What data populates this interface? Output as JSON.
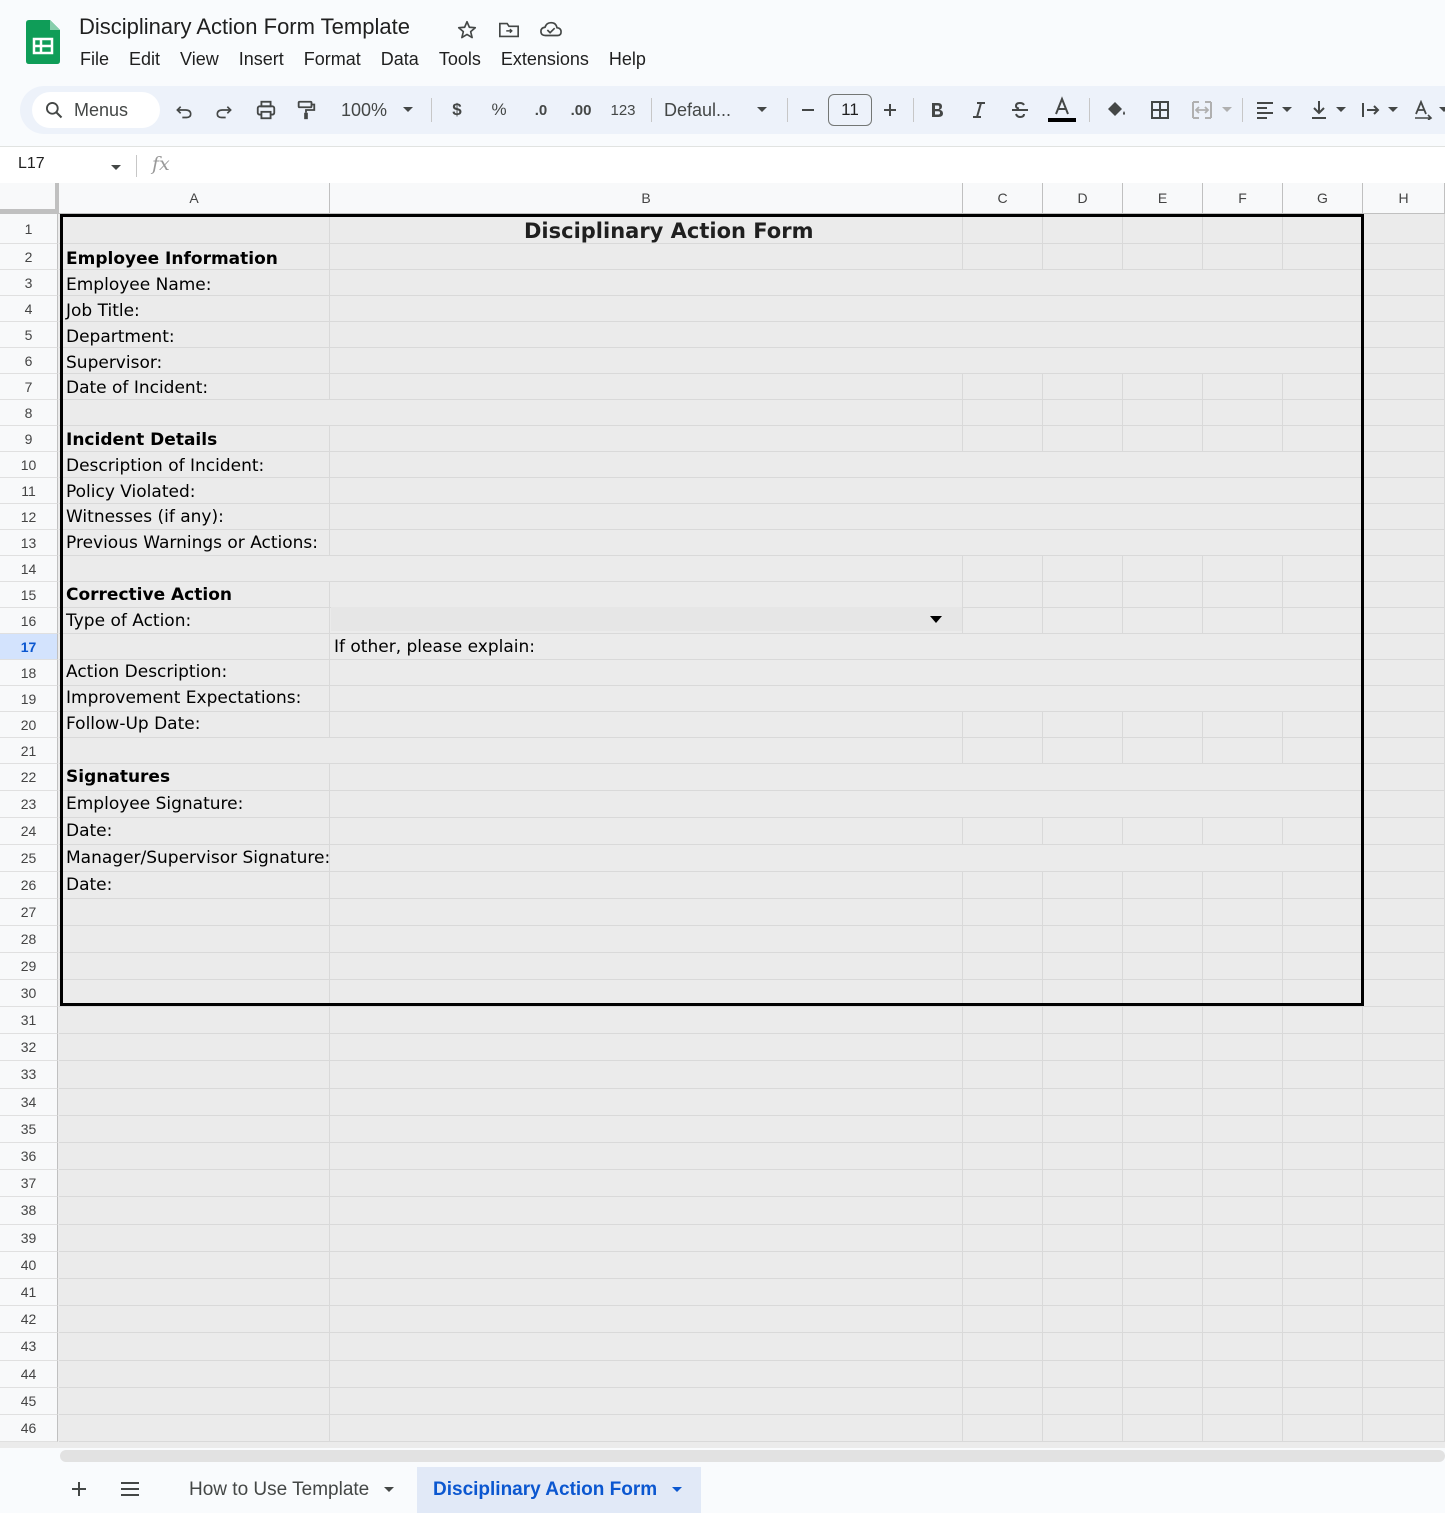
{
  "app": {
    "doc_title": "Disciplinary Action Form Template",
    "menu": [
      "File",
      "Edit",
      "View",
      "Insert",
      "Format",
      "Data",
      "Tools",
      "Extensions",
      "Help"
    ]
  },
  "toolbar": {
    "search_label": "Menus",
    "zoom": "100%",
    "currency": "$",
    "percent": "%",
    "decrease_decimal": ".0",
    "increase_decimal": ".00",
    "number_format": "123",
    "font": "Defaul...",
    "font_size": "11"
  },
  "formula_bar": {
    "cell_ref": "L17",
    "fx": "fx",
    "value": ""
  },
  "grid": {
    "columns": [
      "A",
      "B",
      "C",
      "D",
      "E",
      "F",
      "G",
      "H"
    ],
    "rows": [
      "1",
      "2",
      "3",
      "4",
      "5",
      "6",
      "7",
      "8",
      "9",
      "10",
      "11",
      "12",
      "13",
      "14",
      "15",
      "16",
      "17",
      "18",
      "19",
      "20",
      "21",
      "22",
      "23",
      "24",
      "25",
      "26",
      "27",
      "28",
      "29",
      "30",
      "31",
      "32",
      "33",
      "34",
      "35",
      "36",
      "37",
      "38",
      "39",
      "40",
      "41",
      "42",
      "43",
      "44",
      "45",
      "46"
    ],
    "selected_row": "17",
    "form_title": "Disciplinary Action Form",
    "section_employee": "Employee Information",
    "employee_name": "Employee Name:",
    "job_title": "Job Title:",
    "department": "Department:",
    "supervisor": "Supervisor:",
    "date_incident": "Date of Incident:",
    "section_incident": "Incident Details",
    "description": "Description of Incident:",
    "policy": "Policy Violated:",
    "witnesses": "Witnesses (if any):",
    "previous": "Previous Warnings or Actions:",
    "section_corrective": "Corrective Action",
    "type_action": "Type of Action:",
    "if_other": "If other, please explain:",
    "action_desc": "Action Description:",
    "improvement": "Improvement Expectations:",
    "followup": "Follow-Up Date:",
    "section_signatures": "Signatures",
    "emp_signature": "Employee Signature:",
    "date1": "Date:",
    "mgr_signature": "Manager/Supervisor Signature:",
    "date2": "Date:"
  },
  "sheets": {
    "tabs": [
      "How to Use Template",
      "Disciplinary Action Form"
    ],
    "active": "Disciplinary Action Form"
  }
}
